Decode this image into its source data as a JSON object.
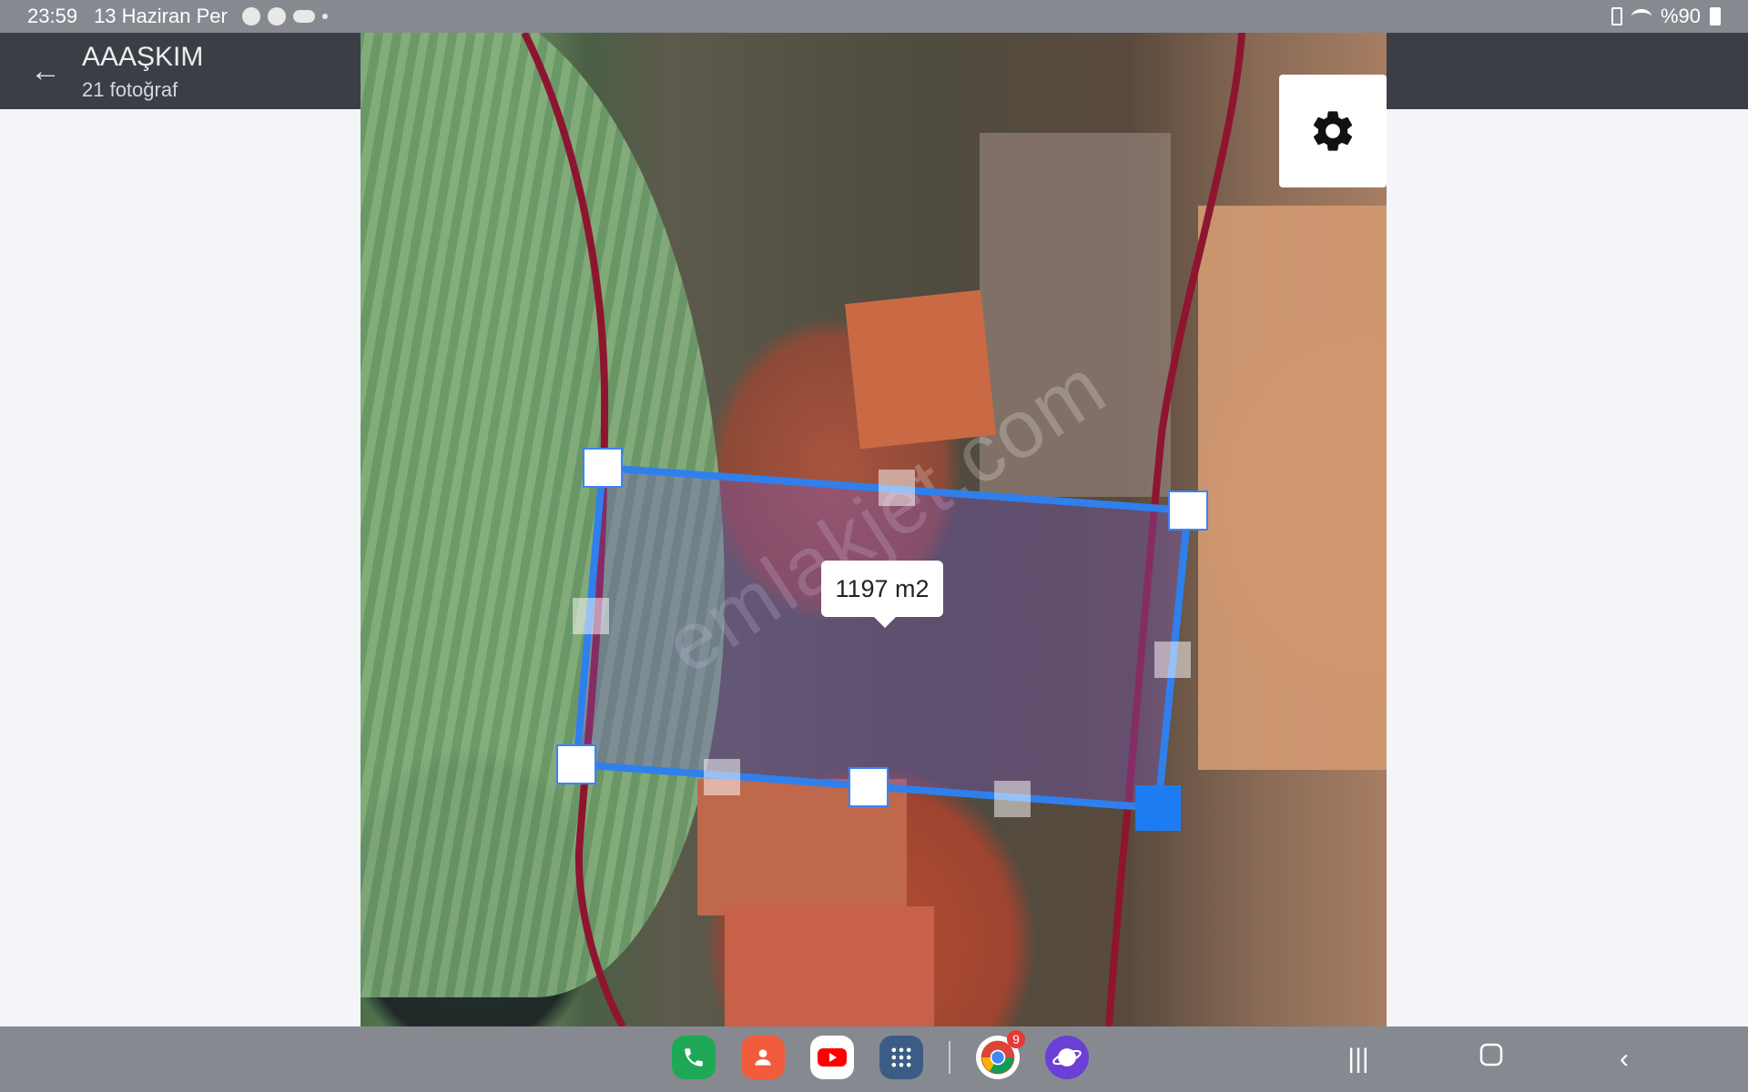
{
  "status_bar": {
    "time": "23:59",
    "date": "13 Haziran Per",
    "battery": "%90"
  },
  "app_bar": {
    "title": "AAAŞKIM",
    "subtitle": "21 fotoğraf"
  },
  "map": {
    "area_label": "1197 m2",
    "watermark": "emlakjet.com",
    "settings_icon": "gear-icon"
  },
  "dock": {
    "apps": [
      {
        "name": "phone",
        "color": "#1fa855"
      },
      {
        "name": "contacts",
        "color": "#f25b3c"
      },
      {
        "name": "youtube",
        "color": "#ffffff"
      },
      {
        "name": "app-drawer",
        "color": "#3c5c85"
      },
      {
        "name": "chrome",
        "color": "#ffffff",
        "badge": "9"
      },
      {
        "name": "internet",
        "color": "#6c3fd6"
      }
    ]
  },
  "nav": {
    "recents": "recents-icon",
    "home": "home-icon",
    "back": "back-icon"
  }
}
